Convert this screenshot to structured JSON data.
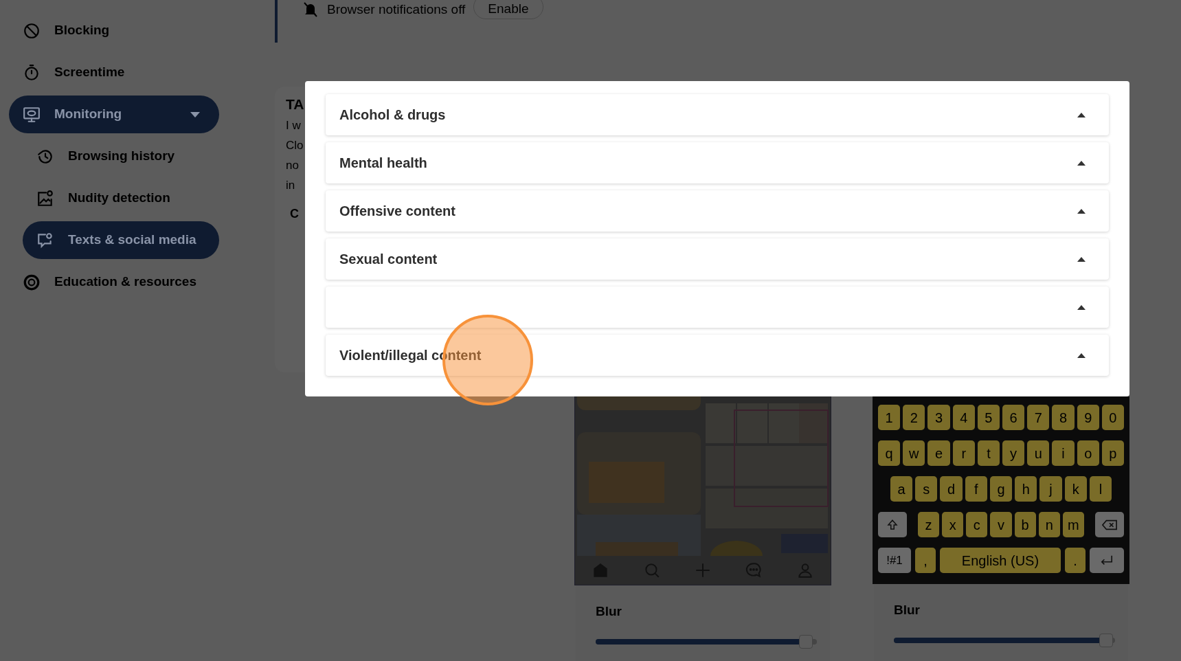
{
  "notification": {
    "text": "Browser notifications off",
    "button": "Enable"
  },
  "sidebar": {
    "items": [
      {
        "label": "Blocking",
        "selected": false
      },
      {
        "label": "Screentime",
        "selected": false
      },
      {
        "label": "Monitoring",
        "selected": true,
        "expanded": true,
        "children": [
          {
            "label": "Browsing history",
            "selected": false
          },
          {
            "label": "Nudity detection",
            "selected": false
          },
          {
            "label": "Texts & social media",
            "selected": true
          }
        ]
      },
      {
        "label": "Education & resources",
        "selected": false
      }
    ]
  },
  "background_card": {
    "title": "TA",
    "lines": [
      "I w",
      "Clo",
      "no",
      "in"
    ],
    "subtitle": "C"
  },
  "modal": {
    "sections": [
      {
        "kind": "titled",
        "title": "Alcohol & drugs"
      },
      {
        "kind": "titled",
        "title": "Mental health"
      },
      {
        "kind": "titled",
        "title": "Offensive content"
      },
      {
        "kind": "titled",
        "title": "Sexual content"
      },
      {
        "kind": "blank"
      },
      {
        "kind": "titled",
        "title": "Violent/illegal content"
      }
    ]
  },
  "previews": [
    {
      "kind": "phone",
      "label": "Blur",
      "level": 0.95
    },
    {
      "kind": "keyboard",
      "label": "Blur",
      "level": 0.96,
      "rows": [
        [
          "1",
          "2",
          "3",
          "4",
          "5",
          "6",
          "7",
          "8",
          "9",
          "0"
        ],
        [
          "q",
          "w",
          "e",
          "r",
          "t",
          "y",
          "u",
          "i",
          "o",
          "p"
        ],
        [
          "a",
          "s",
          "d",
          "f",
          "g",
          "h",
          "j",
          "k",
          "l"
        ],
        [
          "z",
          "x",
          "c",
          "v",
          "b",
          "n",
          "m"
        ]
      ],
      "mode_key": "!#1",
      "comma": ",",
      "space": "English (US)",
      "period": "."
    }
  ]
}
